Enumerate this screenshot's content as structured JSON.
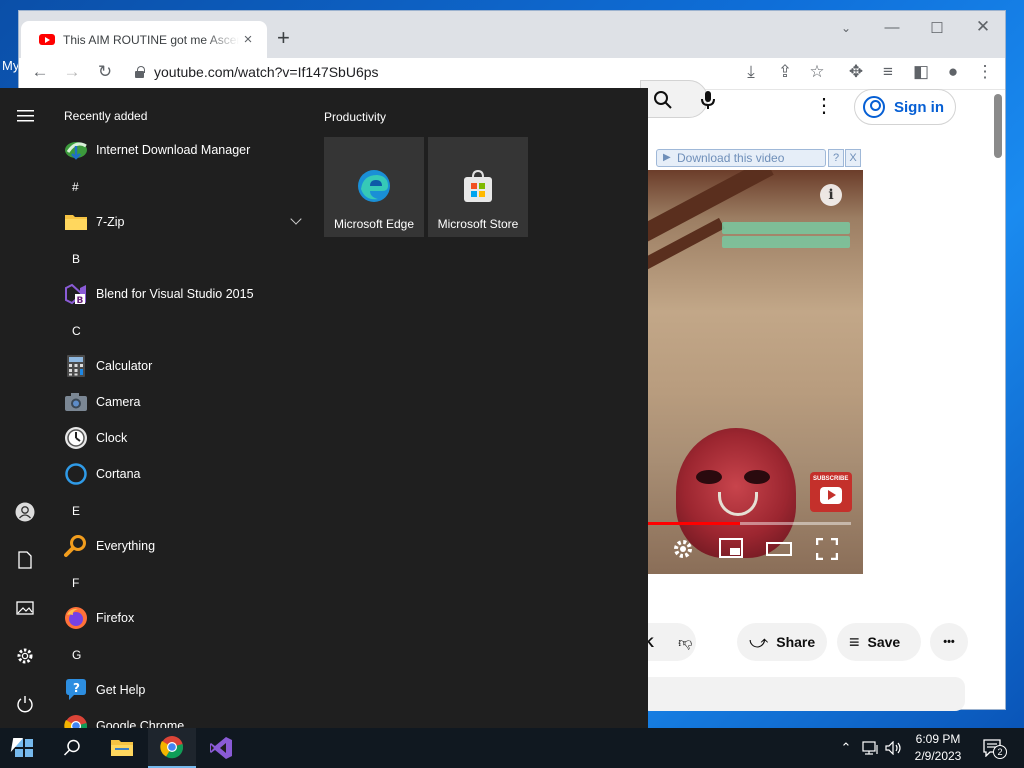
{
  "desktop": {
    "label": "My"
  },
  "browser": {
    "tab_title": "This AIM ROUTINE got me Ascendant",
    "tab_close": "×",
    "new_tab": "+",
    "url": "youtube.com/watch?v=If147SbU6ps",
    "sign_in": "Sign in",
    "idm_download": "Download this video",
    "idm_help": "?",
    "idm_close": "X",
    "actions": {
      "like_count": "K",
      "share": "Share",
      "save": "Save",
      "more": "•••"
    },
    "info": "i"
  },
  "start_menu": {
    "recently_added_header": "Recently added",
    "productivity_header": "Productivity",
    "recent_apps": [
      {
        "label": "Internet Download Manager",
        "icon": "idm-icon"
      }
    ],
    "groups": [
      {
        "letter": "#",
        "apps": [
          {
            "label": "7-Zip",
            "icon": "folder-icon",
            "expandable": true
          }
        ]
      },
      {
        "letter": "B",
        "apps": [
          {
            "label": "Blend for Visual Studio 2015",
            "icon": "blend-icon"
          }
        ]
      },
      {
        "letter": "C",
        "apps": [
          {
            "label": "Calculator",
            "icon": "calculator-icon"
          },
          {
            "label": "Camera",
            "icon": "camera-icon"
          },
          {
            "label": "Clock",
            "icon": "clock-icon"
          },
          {
            "label": "Cortana",
            "icon": "cortana-icon"
          }
        ]
      },
      {
        "letter": "E",
        "apps": [
          {
            "label": "Everything",
            "icon": "everything-icon"
          }
        ]
      },
      {
        "letter": "F",
        "apps": [
          {
            "label": "Firefox",
            "icon": "firefox-icon"
          }
        ]
      },
      {
        "letter": "G",
        "apps": [
          {
            "label": "Get Help",
            "icon": "get-help-icon"
          },
          {
            "label": "Google Chrome",
            "icon": "chrome-icon"
          }
        ]
      }
    ],
    "tiles": [
      {
        "label": "Microsoft Edge",
        "icon": "edge-icon"
      },
      {
        "label": "Microsoft Store",
        "icon": "store-icon"
      }
    ]
  },
  "taskbar": {
    "time": "6:09 PM",
    "date": "2/9/2023",
    "notification_count": "2"
  },
  "colors": {
    "youtube_red": "#ff0000",
    "yt_link_blue": "#065fd4",
    "start_bg": "#1f1f1f",
    "taskbar_bg": "#101820"
  }
}
